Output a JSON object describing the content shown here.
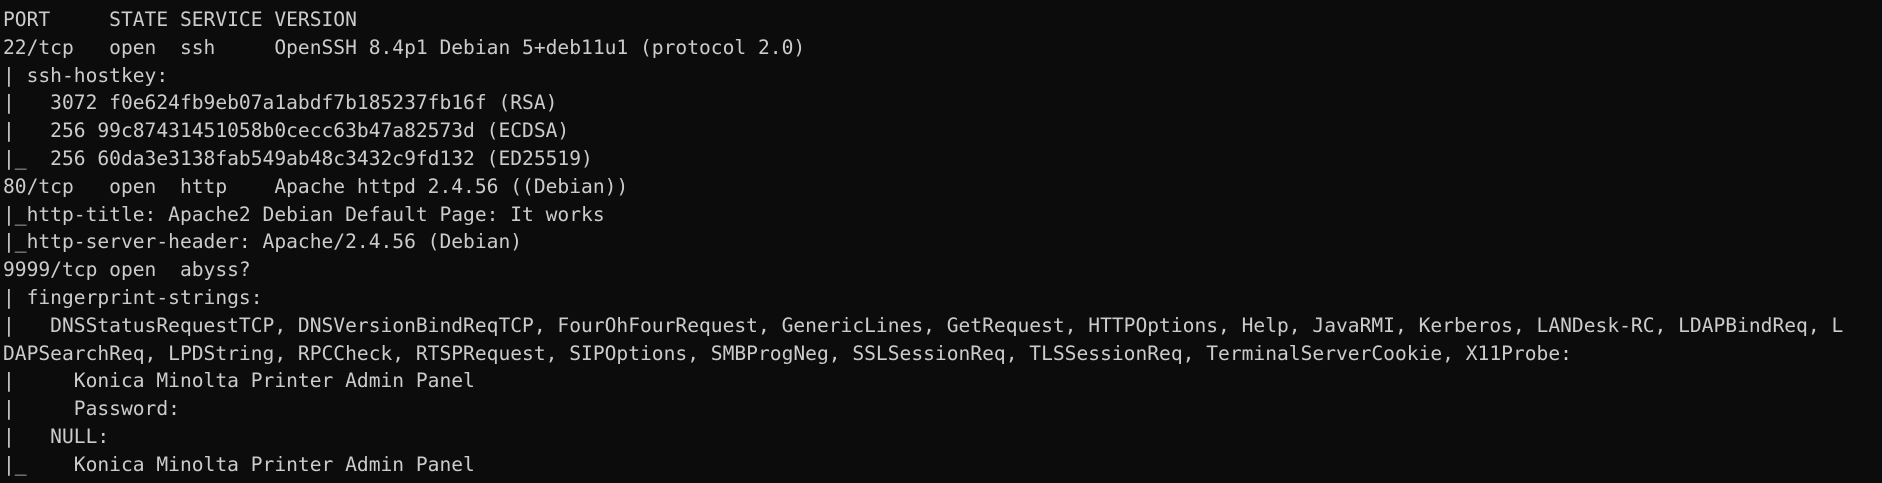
{
  "terminal": {
    "lines": [
      "PORT     STATE SERVICE VERSION",
      "22/tcp   open  ssh     OpenSSH 8.4p1 Debian 5+deb11u1 (protocol 2.0)",
      "| ssh-hostkey:",
      "|   3072 f0e624fb9eb07a1abdf7b185237fb16f (RSA)",
      "|   256 99c87431451058b0cecc63b47a82573d (ECDSA)",
      "|_  256 60da3e3138fab549ab48c3432c9fd132 (ED25519)",
      "80/tcp   open  http    Apache httpd 2.4.56 ((Debian))",
      "|_http-title: Apache2 Debian Default Page: It works",
      "|_http-server-header: Apache/2.4.56 (Debian)",
      "9999/tcp open  abyss?",
      "| fingerprint-strings:",
      "|   DNSStatusRequestTCP, DNSVersionBindReqTCP, FourOhFourRequest, GenericLines, GetRequest, HTTPOptions, Help, JavaRMI, Kerberos, LANDesk-RC, LDAPBindReq, L",
      "DAPSearchReq, LPDString, RPCCheck, RTSPRequest, SIPOptions, SMBProgNeg, SSLSessionReq, TLSSessionReq, TerminalServerCookie, X11Probe:",
      "|     Konica Minolta Printer Admin Panel",
      "|     Password:",
      "|   NULL:",
      "|_    Konica Minolta Printer Admin Panel"
    ]
  },
  "colors": {
    "background": "#0c0c0c",
    "text": "#cccccc"
  }
}
